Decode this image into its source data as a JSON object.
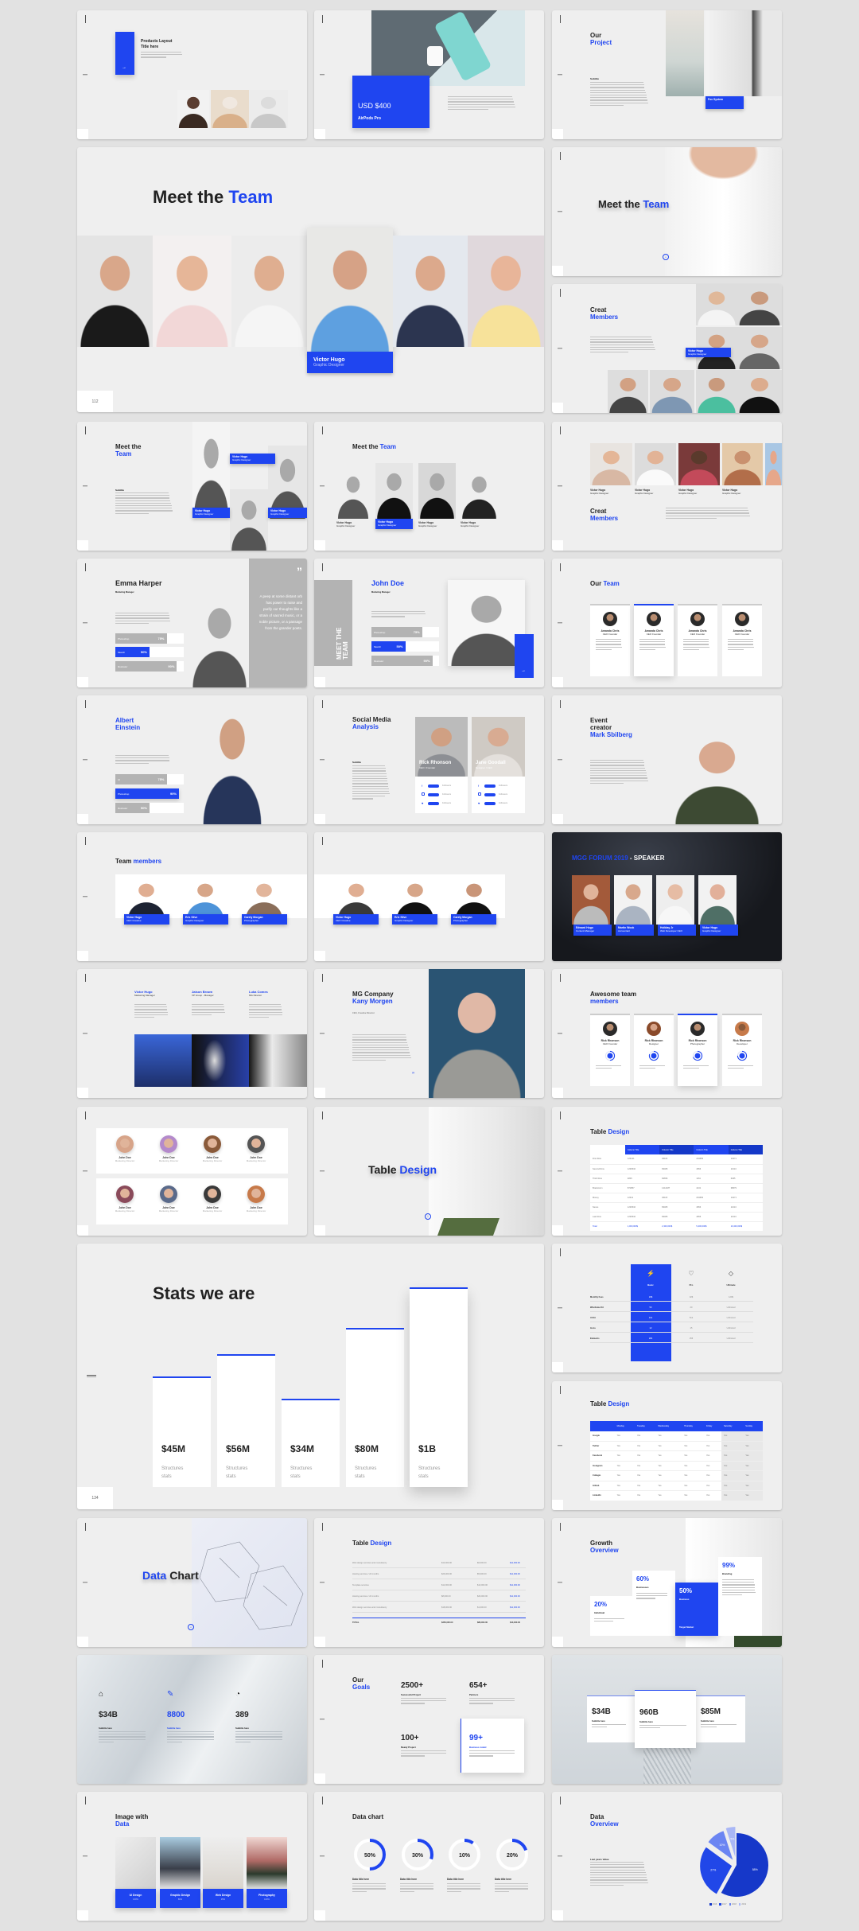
{
  "colors": {
    "accent": "#1f45f0",
    "page_bg": "#e2e2e2",
    "slide_bg": "#efefef"
  },
  "s1": {
    "title1": "Products Layout",
    "title2": "Title here",
    "icon": "arrow-right-icon"
  },
  "s2": {
    "price": "USD $400",
    "product": "AirPods Pro"
  },
  "s3": {
    "title1": "Our",
    "title2": "Project",
    "subtitle": "Subtitle",
    "card": "Fox System"
  },
  "s4": {
    "title_a": "Meet the ",
    "title_b": "Team",
    "name": "Victor Hugo",
    "role": "Graphic Designer",
    "page": "112"
  },
  "s5": {
    "title_a": "Meet the ",
    "title_b": "Team",
    "icon": "arrow-down-circle-icon"
  },
  "s6": {
    "title1": "Creat",
    "title2": "Members",
    "name": "Victor Hugo",
    "role": "Graphic Designer"
  },
  "s7": {
    "title1": "Meet the",
    "title2": "Team",
    "subtitle": "Subtitle",
    "name": "Victor Hugo",
    "role": "Graphic Designer"
  },
  "s8": {
    "title_a": "Meet the ",
    "title_b": "Team",
    "name": "Victor Hugo",
    "role": "Graphic Designer"
  },
  "s9": {
    "title1": "Creat",
    "title2": "Members",
    "name": "Victor Hugo",
    "role": "Graphic Designer"
  },
  "s10": {
    "name": "Emma Harper",
    "role": "Marketing Manager",
    "quote": "A peep at some distant orb has power to raise and purify our thoughts like a strain of sacred music, or a noble picture, or a passage from the grander poets.",
    "skills": [
      {
        "label": "Photoshop",
        "pct": 75
      },
      {
        "label": "Sketch",
        "pct": 50
      },
      {
        "label": "Illustrator",
        "pct": 90
      }
    ]
  },
  "s11": {
    "name": "John Doe",
    "role": "Marketing Manager",
    "vertical": "MEET THE TEAM",
    "skills": [
      {
        "label": "Photoshop",
        "pct": 75
      },
      {
        "label": "Sketch",
        "pct": 50
      },
      {
        "label": "Illustrator",
        "pct": 90
      }
    ]
  },
  "s12": {
    "title_a": "Our ",
    "title_b": "Team",
    "name": "Amanda Chris",
    "role": "CEO Founder"
  },
  "s13": {
    "title1": "Albert",
    "title2": "Einstein",
    "skills": [
      {
        "label": "UI",
        "pct": 75
      },
      {
        "label": "Photoshop",
        "pct": 90
      },
      {
        "label": "Illustrator",
        "pct": 50
      }
    ]
  },
  "s14": {
    "title1": "Social Media",
    "title2": "Analysis",
    "subtitle": "Subtitle",
    "people": [
      {
        "name": "Rick Rhonson",
        "role": "CEO / Founder"
      },
      {
        "name": "Jane Goodall",
        "role": "Designer / CEO"
      }
    ],
    "followers": "Followers",
    "socials": [
      "facebook-icon",
      "instagram-icon",
      "twitter-icon"
    ]
  },
  "s15": {
    "title1": "Event",
    "title2": "creator",
    "title3": "Mark Sbilberg"
  },
  "s16": {
    "title_a": "Team ",
    "title_b": "members",
    "people": [
      {
        "name": "Victor Hugo",
        "role": "CEO Creative"
      },
      {
        "name": "Eric Silve",
        "role": "Graphic Designer"
      },
      {
        "name": "Carely Morgan",
        "role": "Photographer"
      }
    ]
  },
  "s18": {
    "title_a": "MGG FORUM 2019",
    "title_b": " - SPEAKER",
    "people": [
      {
        "name": "Edward Hugo",
        "role": "Content Manager"
      },
      {
        "name": "Martin Wook",
        "role": "Accountant"
      },
      {
        "name": "Holiday Jr",
        "role": "Web Developer CEO"
      },
      {
        "name": "Victor Hugo",
        "role": "Graphic Designer"
      }
    ]
  },
  "s19": {
    "people": [
      {
        "name": "Victor Hugo",
        "role": "Marketing Manager"
      },
      {
        "name": "Jaison Brown",
        "role": "VP Group - Manager"
      },
      {
        "name": "Luka Comes",
        "role": "MG Director"
      }
    ]
  },
  "s20": {
    "title1": "MG Company",
    "title2": "Kany Morgen",
    "role": "CEO, Creative Director"
  },
  "s21": {
    "title1": "Awesome team",
    "title2": "members",
    "people": [
      {
        "name": "Rick Rhonson",
        "role": "CEO Founder",
        "pct": 50
      },
      {
        "name": "Rick Rhonson",
        "role": "Designer",
        "pct": 80
      },
      {
        "name": "Rick Rhonson",
        "role": "Photographer",
        "pct": 70
      },
      {
        "name": "Rick Rhonson",
        "role": "Developer",
        "pct": 75
      }
    ]
  },
  "s22": {
    "name": "John Doe",
    "role": "Marketing Director"
  },
  "s23": {
    "title_a": "Table ",
    "title_b": "Design"
  },
  "s24": {
    "title_a": "Table ",
    "title_b": "Design",
    "headers": [
      "",
      "Column Title",
      "Column Title",
      "Column Title",
      "Column Title"
    ],
    "rows": [
      [
        "First Row",
        "123121",
        "36115",
        "234656",
        "13271"
      ],
      [
        "Second Row",
        "1233532",
        "83465",
        "4656",
        "11313"
      ],
      [
        "Third Row",
        "4845",
        "84656",
        "1161",
        "6465"
      ],
      [
        "Brainstorm",
        "871857",
        "1212187",
        "4131",
        "38679"
      ],
      [
        "Money",
        "12312",
        "36115",
        "234656",
        "13271"
      ],
      [
        "Nexus",
        "1233532",
        "83465",
        "4656",
        "11313"
      ],
      [
        "Last Row",
        "1233532",
        "83465",
        "4656",
        "11313"
      ]
    ],
    "total": [
      "Total",
      "1,000,000$",
      "2,300,000$",
      "5,400,000$",
      "10,400,000$"
    ]
  },
  "s25": {
    "title": "Stats we are",
    "page": "134",
    "stats": [
      {
        "value": "$45M",
        "label": "Structures stats",
        "level": 45
      },
      {
        "value": "$56M",
        "label": "Structures stats",
        "level": 56
      },
      {
        "value": "$34M",
        "label": "Structures stats",
        "level": 34
      },
      {
        "value": "$80M",
        "label": "Structures stats",
        "level": 80
      },
      {
        "value": "$1B",
        "label": "Structures stats",
        "level": 100
      }
    ]
  },
  "s26": {
    "plans": [
      {
        "name": "Basic",
        "icon": "lightning-icon"
      },
      {
        "name": "Pro",
        "icon": "heart-icon"
      },
      {
        "name": "Ultimate",
        "icon": "diamond-icon"
      }
    ],
    "rows": [
      [
        "Monthly Fees",
        "20$",
        "32$",
        "120$"
      ],
      [
        "Wireframe Kit",
        "50",
        "20",
        "Unlimited"
      ],
      [
        "UI Kit",
        "312",
        "512",
        "Unlimited"
      ],
      [
        "Icons",
        "12",
        "15",
        "Unlimited"
      ],
      [
        "Elements",
        "284",
        "256",
        "Unlimited"
      ]
    ]
  },
  "s27": {
    "title_a": "Table ",
    "title_b": "Design",
    "days": [
      "Monday",
      "Tuesday",
      "Wednesday",
      "Thursday",
      "Friday",
      "Saturday",
      "Sunday"
    ],
    "rows": [
      "Google",
      "Twitter",
      "Facebook",
      "Instagram",
      "Collegio",
      "Github",
      "LinkedIn"
    ],
    "cell": "Yes"
  },
  "s28": {
    "title_a": "Data ",
    "title_b": "Chart"
  },
  "s29": {
    "title_a": "Table ",
    "title_b": "Design",
    "rows": [
      [
        "Web design services and consultancy",
        "$13,000.00",
        "$6,000.00",
        "$11,000.00"
      ],
      [
        "Hosting services / 24 months",
        "$26,000.00",
        "$5,000.00",
        "$11,000.00"
      ],
      [
        "Template services",
        "$12,000.00",
        "$13,000.00",
        "$11,000.00"
      ],
      [
        "Hosting services / 24 months",
        "$8,000.00",
        "$26,000.00",
        "$11,000.00"
      ],
      [
        "Web design services and consultancy",
        "$18,000.00",
        "$1,000.00",
        "$11,000.00"
      ]
    ],
    "total": [
      "TOTAL",
      "$350,000.00",
      "$86,000.00",
      "$13,000.00"
    ]
  },
  "s30": {
    "title1": "Growth",
    "title2": "Overview",
    "items": [
      {
        "pct": "20%",
        "label": "Individual"
      },
      {
        "pct": "60%",
        "label": "Businesses"
      },
      {
        "pct": "50%",
        "label": "Business",
        "foot": "Target Market"
      },
      {
        "pct": "99%",
        "label": "Branding"
      }
    ]
  },
  "s31": {
    "items": [
      {
        "icon": "home-icon",
        "value": "$34B",
        "sub": "Subtitle here"
      },
      {
        "icon": "wrench-icon",
        "value": "8800",
        "sub": "Subtitle here"
      },
      {
        "icon": "chat-icon",
        "value": "389",
        "sub": "Subtitle here"
      }
    ]
  },
  "s32": {
    "title1": "Our",
    "title2": "Goals",
    "items": [
      {
        "value": "2500+",
        "label": "Successful Project"
      },
      {
        "value": "654+",
        "label": "Partners"
      },
      {
        "value": "100+",
        "label": "Ready Project"
      },
      {
        "value": "99+",
        "label": "Business model"
      }
    ]
  },
  "s33": {
    "items": [
      {
        "value": "$34B",
        "sub": "Subtitle here"
      },
      {
        "value": "960B",
        "sub": "Subtitle here"
      },
      {
        "value": "$85M",
        "sub": "Subtitle here"
      }
    ]
  },
  "s34": {
    "title1": "Image with",
    "title2": "Data",
    "items": [
      {
        "label": "UI Design",
        "pct": "100%"
      },
      {
        "label": "Graphic Design",
        "pct": "80%"
      },
      {
        "label": "Web Design",
        "pct": "95%"
      },
      {
        "label": "Photography",
        "pct": "100%"
      }
    ]
  },
  "s35": {
    "title": "Data chart",
    "rings": [
      {
        "pct": 50,
        "text": "50%",
        "label": "Data title here"
      },
      {
        "pct": 30,
        "text": "30%",
        "label": "Data title here"
      },
      {
        "pct": 10,
        "text": "10%",
        "label": "Data title here"
      },
      {
        "pct": 20,
        "text": "20%",
        "label": "Data title here"
      }
    ]
  },
  "s36": {
    "title1": "Data",
    "title2": "Overview",
    "subtitle": "Last years Value",
    "pie": [
      {
        "label": "2016",
        "value": 58,
        "color": "#1638c9"
      },
      {
        "label": "2017",
        "value": 27,
        "color": "#2147e8"
      },
      {
        "label": "2018",
        "value": 10,
        "color": "#6b85f2"
      },
      {
        "label": "2019",
        "value": 5,
        "color": "#a9b7f6"
      }
    ]
  }
}
